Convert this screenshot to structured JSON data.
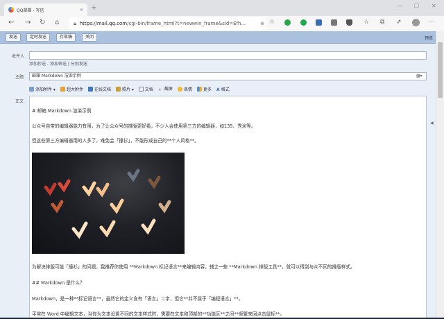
{
  "browser": {
    "tab_title": "QQ邮箱 - 写信",
    "tab_close": "×",
    "new_tab": "+",
    "url_prefix": "https://mail.qq.com",
    "url_rest": "/cgi-bin/frame_html?t=newwin_frame&sid=Efh...",
    "more": "···"
  },
  "toolbar": {
    "send": "发送",
    "scheduled_send": "定时发送",
    "save_draft": "存草稿",
    "close": "关闭",
    "preview": "预览"
  },
  "form": {
    "to_label": "收件人",
    "to_value": "",
    "cc_link": "添加抄送",
    "sep1": " - ",
    "bcc_link": "添加密送",
    "sep2": " | ",
    "separate_send": "分别发送",
    "subject_label": "主题",
    "subject_value": "邮箱 Markdown 渲染示例",
    "body_label": "正文"
  },
  "compose_tools": [
    "添加附件",
    "超大附件",
    "在线文档",
    "照片",
    "文档",
    "截屏",
    "表情",
    "更多",
    "格式"
  ],
  "body": {
    "lines": [
      "# 邮箱 Markdown 渲染示例",
      "公众号自带的编辑器能力有限，为了让公众号的排版更好看，不少人会使用第三方的编辑器，如135、秀米等。",
      "但这些第三方编辑器用的人多了，难免会「撞衫」，不能形成自己的**个人风格**。",
      "为解决排版可能「撞衫」的问题，我推荐你使用 **Markdown 标记语言**来编辑内容，辅之一些 **Markdown 排版工具**，就可以得到与众不同的排版样式。",
      "## Markdown 是什么？",
      "Markdown，是一种**标记语言**，虽然它的定义含有「语言」二字，但它**并不属于「编程语言」**。",
      "平常在 Word 中编辑文本，当你为文本设置不同的文本样式时，需要在文本和顶部的**功能区**之间**频繁来回点击鼠标**。"
    ]
  }
}
